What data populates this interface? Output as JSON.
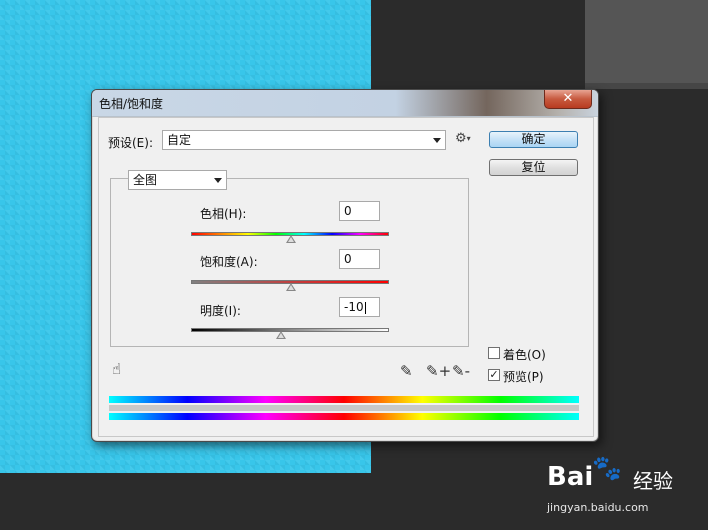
{
  "dialog": {
    "title": "色相/饱和度",
    "close_label": "✕"
  },
  "preset": {
    "label": "预设(E):",
    "value": "自定"
  },
  "settings_icon": "⚙",
  "buttons": {
    "ok": "确定",
    "reset": "复位"
  },
  "channel": {
    "value": "全图"
  },
  "hue": {
    "label": "色相(H):",
    "value": "0"
  },
  "saturation": {
    "label": "饱和度(A):",
    "value": "0"
  },
  "lightness": {
    "label": "明度(I):",
    "value": "-10"
  },
  "sliders": {
    "hue": 0,
    "saturation": 0,
    "lightness": -10
  },
  "colorize": {
    "label": "着色(O)",
    "checked": false
  },
  "preview": {
    "label": "预览(P)",
    "checked": true,
    "check_glyph": "✓"
  },
  "icons": {
    "hand": "☝",
    "eyedropper": "✎",
    "eyedropper_plus": "✎+",
    "eyedropper_minus": "✎-"
  },
  "watermark": {
    "logo_a": "Bai",
    "logo_paw": "🐾",
    "logo_b": "经验",
    "url": "jingyan.baidu.com"
  }
}
